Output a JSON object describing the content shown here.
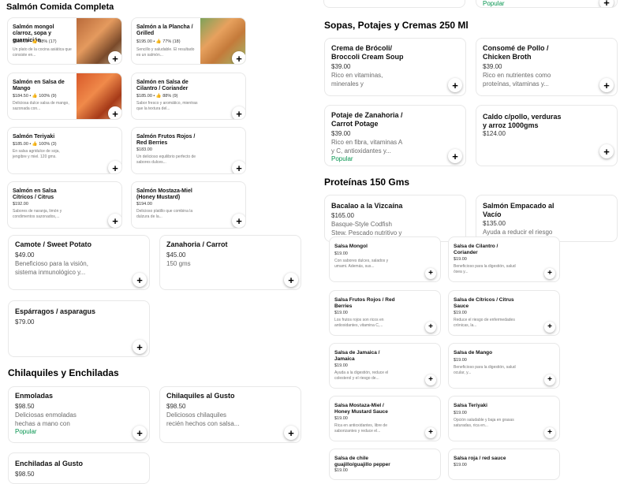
{
  "sections": {
    "salmon": "Salmón Comida Completa",
    "sopas": "Sopas, Potajes y Cremas 250 Ml",
    "proteinas": "Proteínas 150 Gms",
    "chilaquiles": "Chilaquiles y Enchiladas"
  },
  "top_popular": "Popular",
  "salmon_items": [
    {
      "name": "Salmón mongol c/arroz, sopa y guarnición",
      "price": "$186.00 • 👍 88% (17)",
      "desc": "Un plato de la cocina asiática que consiste en..."
    },
    {
      "name": "Salmón a la Plancha / Grilled",
      "price": "$195.00 • 👍 77% (18)",
      "desc": "Sencillo y saludable. El resultado es un salmón..."
    },
    {
      "name": "Salmón en Salsa de Mango",
      "price": "$184.50 • 👍 100% (9)",
      "desc": "Deliciosa dulce salsa de mango, sazonada con..."
    },
    {
      "name": "Salmón en Salsa de Cilantro / Coriander",
      "price": "$185.00 • 👍 88% (9)",
      "desc": "Sabor fresco y aromático, mientras que la textura del..."
    },
    {
      "name": "Salmón Teriyaki",
      "price": "$185.00 • 👍 100% (3)",
      "desc": "En salsa agridulce de soja, jengibre y miel. 120 gms."
    },
    {
      "name": "Salmón Frutos Rojos / Red Berries",
      "price": "$183.00",
      "desc": "Un delicioso equilibrio perfecto de sabores dulces..."
    },
    {
      "name": "Salmón en Salsa Cítricos / Citrus",
      "price": "$192.00",
      "desc": "Sabores de naranja, limón y condimentos sazonados,..."
    },
    {
      "name": "Salmón Mostaza-Miel (Honey Mustard)",
      "price": "$194.00",
      "desc": "Delicioso platillo que combina la dulzura de la..."
    }
  ],
  "veg_items": [
    {
      "name": "Camote / Sweet Potato",
      "price": "$49.00",
      "desc": "Beneficioso para la visión, sistema inmunológico y..."
    },
    {
      "name": "Zanahoria / Carrot",
      "price": "$45.00",
      "desc": "150 gms"
    },
    {
      "name": "Espárragos / asparagus",
      "price": "$79.00",
      "desc": ""
    }
  ],
  "chila_items": [
    {
      "name": "Enmoladas",
      "price": "$98.50",
      "desc": "Deliciosas enmoladas hechas a mano con tortilla...",
      "popular": "Popular"
    },
    {
      "name": "Chilaquiles al Gusto",
      "price": "$98.50",
      "desc": "Deliciosos chilaquiles recién hechos con salsa..."
    },
    {
      "name": "Enchiladas al Gusto",
      "price": "$98.50"
    }
  ],
  "sopa_items": [
    {
      "name": "Crema de Brócoli/ Broccoli Cream Soup",
      "price": "$39.00",
      "desc": "Rico en vitaminas, minerales y antioxidantes,..."
    },
    {
      "name": "Consomé de Pollo / Chicken Broth",
      "price": "$39.00",
      "desc": "Rico en nutrientes como proteínas, vitaminas y..."
    },
    {
      "name": "Potaje de Zanahoria / Carrot Potage",
      "price": "$39.00",
      "desc": "Rico en fibra, vitaminas A y C, antioxidantes y...",
      "popular": "Popular"
    },
    {
      "name": "Caldo c/pollo, verduras y arroz 1000gms",
      "price": "$124.00",
      "desc": ""
    }
  ],
  "prot_items": [
    {
      "name": "Bacalao a la Vizcaína",
      "price": "$165.00",
      "desc": "Basque-Style Codfish Stew. Pescado nutritivo y rico en..."
    },
    {
      "name": "Salmón Empacado al Vacío",
      "price": "$135.00",
      "desc": "Ayuda a reducir el riesgo de..."
    }
  ],
  "salsa_items": [
    {
      "name": "Salsa Mongol",
      "price": "$19.00",
      "desc": "Con sabores dulces, salados y umami. Además, sus..."
    },
    {
      "name": "Salsa de Cilantro / Coriander",
      "price": "$19.00",
      "desc": "Beneficioso para la digestión, salud ósea y..."
    },
    {
      "name": "Salsa Frutos Rojos / Red Berries",
      "price": "$19.00",
      "desc": "Los frutos rojos son ricos en antioxidantes, vitamina C,..."
    },
    {
      "name": "Salsa de Cítricos / Citrus Sauce",
      "price": "$19.00",
      "desc": "Reduce el riesgo de enfermedades crónicas, la..."
    },
    {
      "name": "Salsa de Jamaica / Jamaica",
      "price": "$19.00",
      "desc": "Ayuda a la digestión, reduce el colesterol y el riesgo de..."
    },
    {
      "name": "Salsa de Mango",
      "price": "$19.00",
      "desc": "Beneficioso para la digestión, salud ocular, y..."
    },
    {
      "name": "Salsa Mostaza-Miel / Honey Mustard Sauce",
      "price": "$19.00",
      "desc": "Rica en antioxidantes, libre de saborizantes y reduce el..."
    },
    {
      "name": "Salsa Teriyaki",
      "price": "$19.00",
      "desc": "Opción saludable y baja en grasas saturadas, rica en..."
    },
    {
      "name": "Salsa de chile guajillo/guajillo pepper",
      "price": "$19.00"
    },
    {
      "name": "Salsa roja / red sauce",
      "price": "$19.00"
    }
  ],
  "colors": {
    "popular": "#05944f",
    "border": "#e8e8e8"
  },
  "add_icon": "plus-icon"
}
